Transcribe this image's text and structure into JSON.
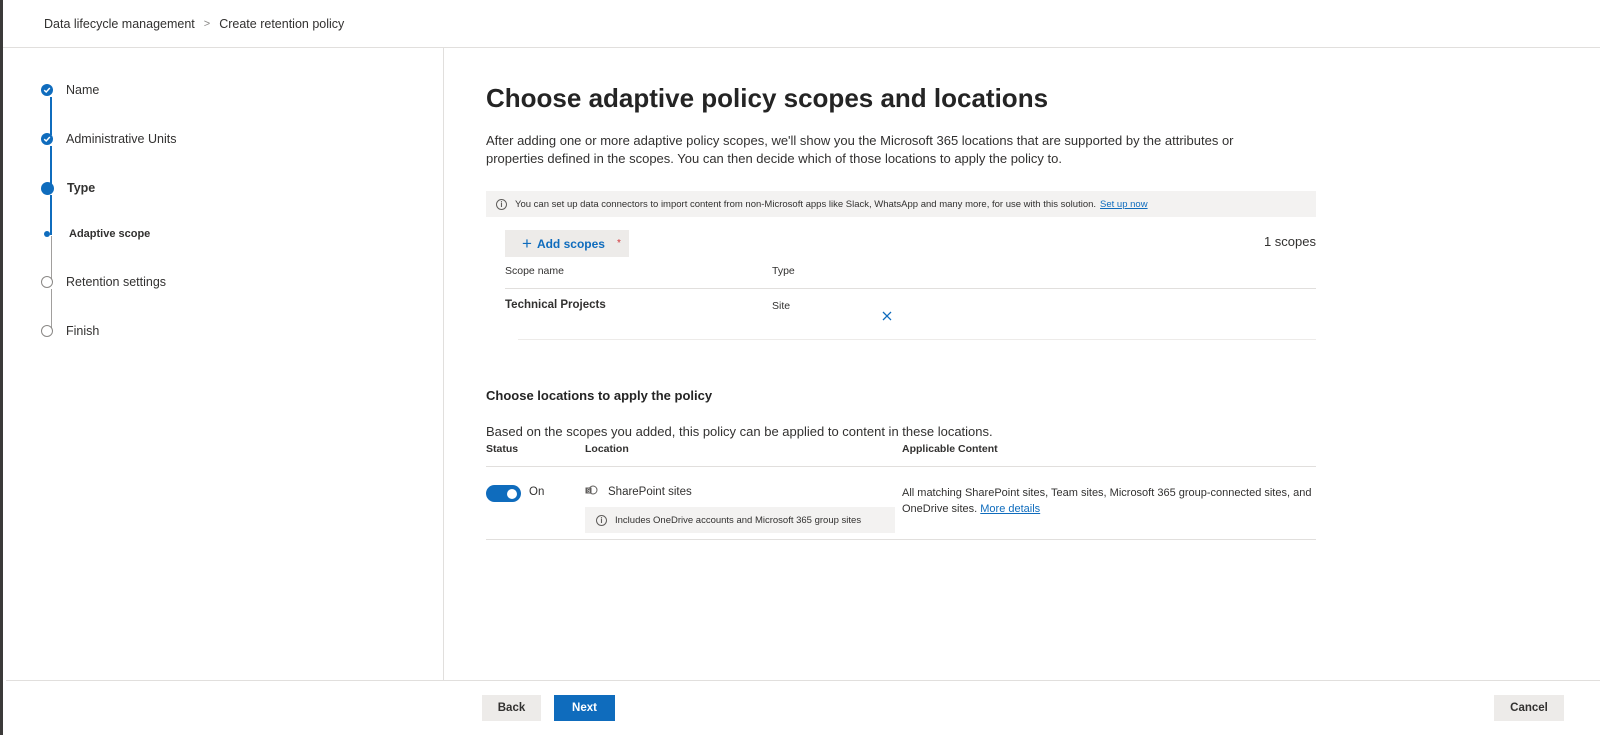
{
  "breadcrumb": {
    "items": [
      "Data lifecycle management",
      "Create retention policy"
    ],
    "separator": ">"
  },
  "wizard": {
    "steps": [
      {
        "label": "Name",
        "status": "done"
      },
      {
        "label": "Administrative Units",
        "status": "done"
      },
      {
        "label": "Type",
        "status": "current"
      },
      {
        "label": "Adaptive scope",
        "status": "current-substep"
      },
      {
        "label": "Retention settings",
        "status": "todo"
      },
      {
        "label": "Finish",
        "status": "todo"
      }
    ]
  },
  "main": {
    "title": "Choose adaptive policy scopes and locations",
    "intro": "After adding one or more adaptive policy scopes, we'll show you the Microsoft 365 locations that are supported by the attributes or properties defined in the scopes. You can then decide which of those locations to apply the policy to.",
    "infobar": {
      "text": "You can set up data connectors to import content from non-Microsoft apps like Slack, WhatsApp and many more, for use with this solution.",
      "link": "Set up now"
    },
    "add_scopes_label": "Add scopes",
    "required_mark": "*",
    "scope_count": "1 scopes",
    "scopes_table": {
      "headers": [
        "Scope name",
        "Type"
      ],
      "rows": [
        {
          "name": "Technical Projects",
          "type": "Site"
        }
      ]
    },
    "locations": {
      "heading": "Choose locations to apply the policy",
      "intro": "Based on the scopes you added, this policy can be applied to content in these locations.",
      "headers": [
        "Status",
        "Location",
        "Applicable Content"
      ],
      "rows": [
        {
          "status": "On",
          "enabled": true,
          "location": "SharePoint sites",
          "note": "Includes OneDrive accounts and Microsoft 365 group sites",
          "content": "All matching SharePoint sites, Team sites, Microsoft 365 group-connected sites, and OneDrive sites.",
          "content_link": "More details"
        }
      ]
    }
  },
  "footer": {
    "back": "Back",
    "next": "Next",
    "cancel": "Cancel"
  },
  "colors": {
    "accent": "#0f6cbd",
    "required": "#d13438"
  }
}
